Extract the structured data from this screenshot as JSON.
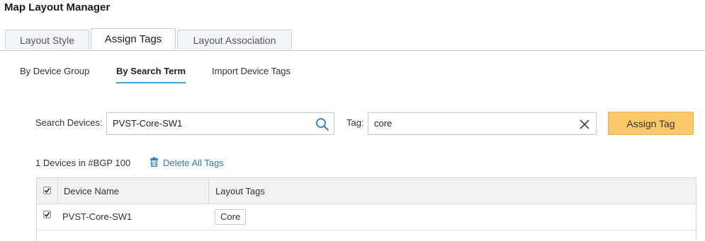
{
  "page_title": "Map Layout Manager",
  "tabs": [
    {
      "label": "Layout Style",
      "active": false
    },
    {
      "label": "Assign Tags",
      "active": true
    },
    {
      "label": "Layout Association",
      "active": false
    }
  ],
  "subtabs": [
    {
      "label": "By Device Group",
      "active": false
    },
    {
      "label": "By Search Term",
      "active": true
    },
    {
      "label": "Import Device Tags",
      "active": false
    }
  ],
  "search": {
    "label": "Search Devices:",
    "value": "PVST-Core-SW1",
    "icon": "search-icon"
  },
  "tag": {
    "label": "Tag:",
    "value": "core",
    "icon": "clear-icon"
  },
  "assign_button": "Assign Tag",
  "device_count": "1 Devices in #BGP 100",
  "delete_all": "Delete All Tags",
  "table": {
    "columns": [
      "Device Name",
      "Layout Tags"
    ],
    "header_checked": true,
    "rows": [
      {
        "checked": true,
        "device": "PVST-Core-SW1",
        "tags": [
          "Core"
        ]
      }
    ]
  },
  "colors": {
    "accent": "#4aa6d6",
    "button": "#fcc968",
    "link": "#2e7db5"
  }
}
